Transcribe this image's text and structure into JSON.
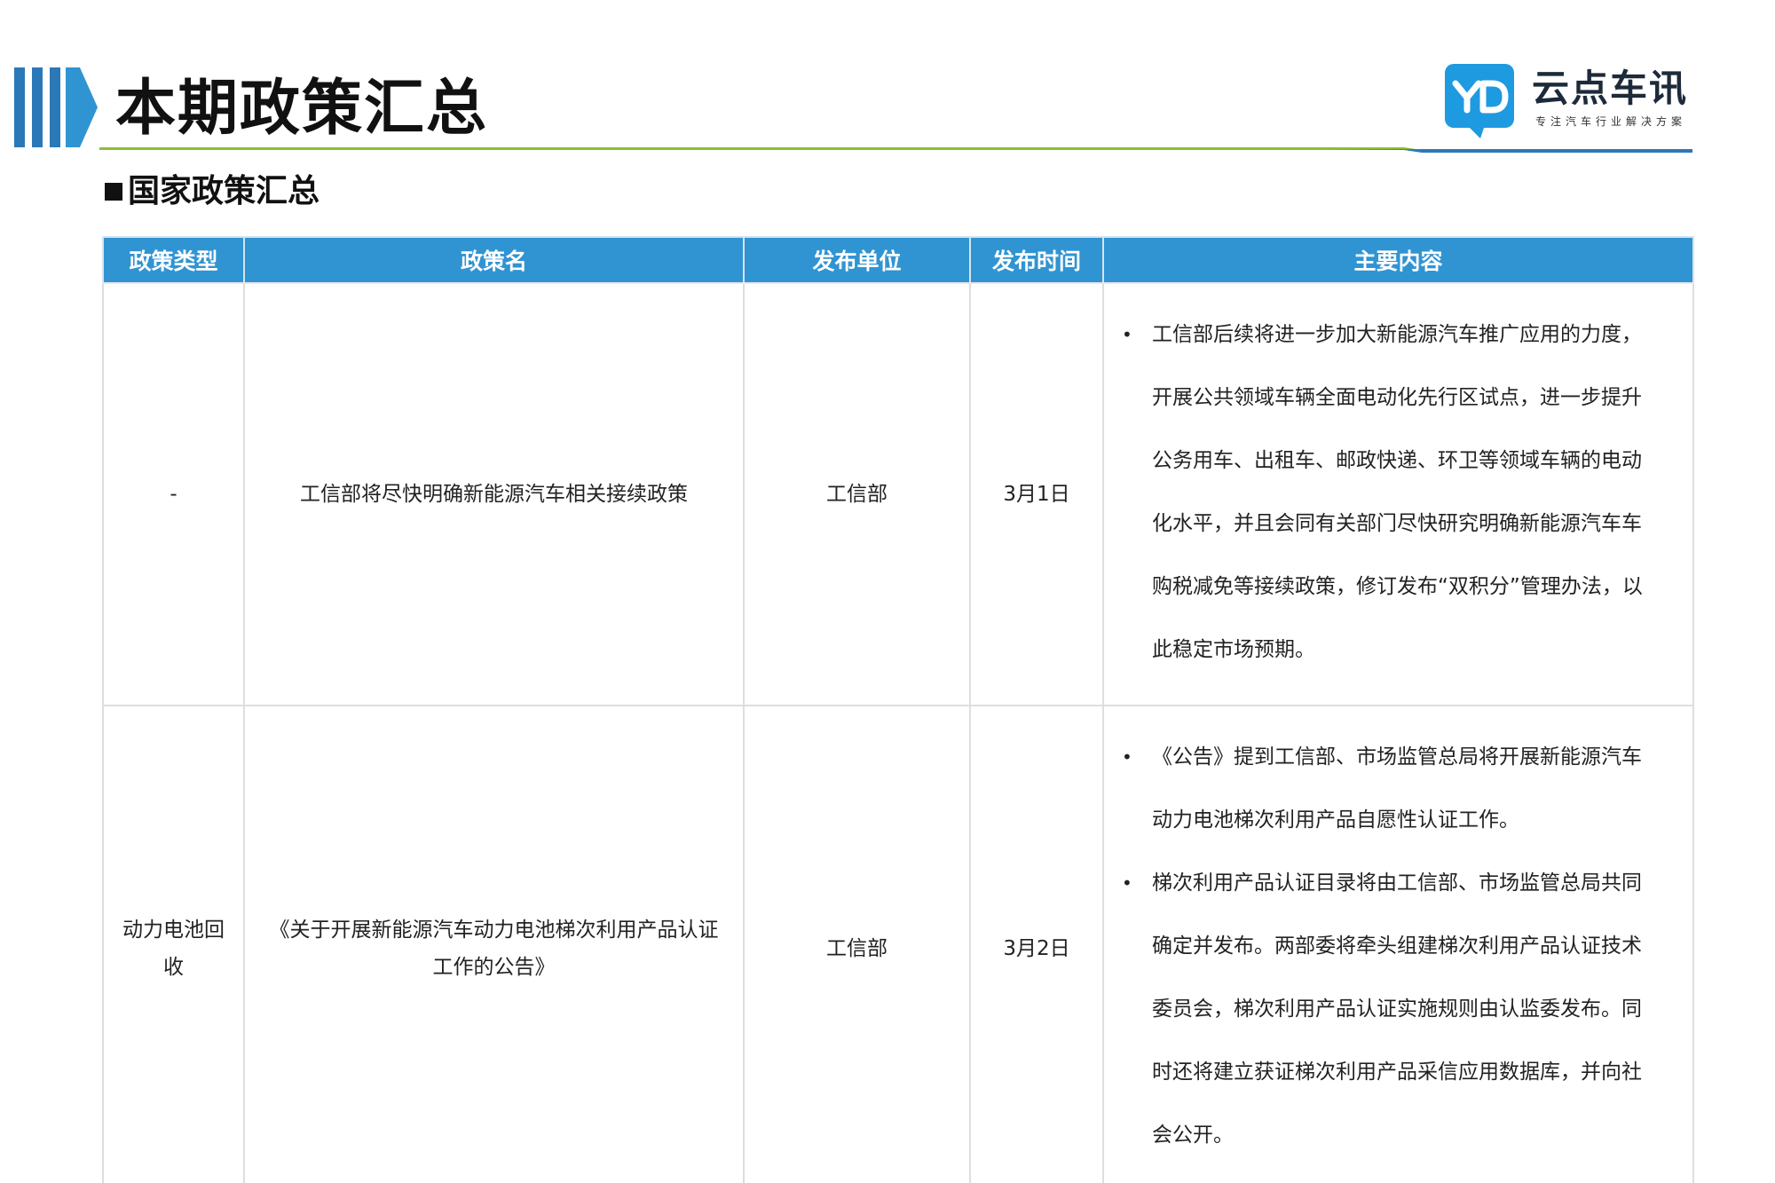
{
  "page": {
    "title": "本期政策汇总",
    "section_title": "国家政策汇总"
  },
  "logo": {
    "name": "云点车讯",
    "tagline": "专注汽车行业解决方案",
    "icon": "yd-logo-icon",
    "color": "#1e9ae0"
  },
  "colors": {
    "header_blue": "#3194d2",
    "rule_green": "#8cbf2f",
    "rule_blue": "#2b78b8"
  },
  "table": {
    "headers": [
      "政策类型",
      "政策名",
      "发布单位",
      "发布时间",
      "主要内容"
    ],
    "rows": [
      {
        "type": "-",
        "name": "工信部将尽快明确新能源汽车相关接续政策",
        "issuer": "工信部",
        "date": "3月1日",
        "content": [
          "工信部后续将进一步加大新能源汽车推广应用的力度，开展公共领域车辆全面电动化先行区试点，进一步提升公务用车、出租车、邮政快递、环卫等领域车辆的电动化水平，并且会同有关部门尽快研究明确新能源汽车车购税减免等接续政策，修订发布“双积分”管理办法，以此稳定市场预期。"
        ]
      },
      {
        "type": "动力电池回收",
        "name": "《关于开展新能源汽车动力电池梯次利用产品认证工作的公告》",
        "issuer": "工信部",
        "date": "3月2日",
        "content": [
          "《公告》提到工信部、市场监管总局将开展新能源汽车动力电池梯次利用产品自愿性认证工作。",
          "梯次利用产品认证目录将由工信部、市场监管总局共同确定并发布。两部委将牵头组建梯次利用产品认证技术委员会，梯次利用产品认证实施规则由认监委发布。同时还将建立获证梯次利用产品采信应用数据库，并向社会公开。"
        ]
      }
    ]
  }
}
